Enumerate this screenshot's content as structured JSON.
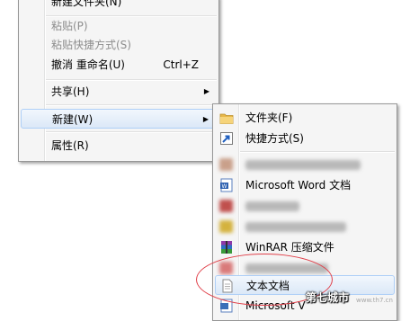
{
  "main_menu": {
    "top_partial": "新建文件夹(N)",
    "paste": "粘贴(P)",
    "paste_shortcut": "粘贴快捷方式(S)",
    "undo_rename": "撤消 重命名(U)",
    "undo_shortcut": "Ctrl+Z",
    "share": "共享(H)",
    "new": "新建(W)",
    "properties": "属性(R)"
  },
  "sub_menu": {
    "folder": "文件夹(F)",
    "shortcut": "快捷方式(S)",
    "word": "Microsoft Word 文档",
    "winrar": "WinRAR 压缩文件",
    "text_doc": "文本文档",
    "partial_bottom": "Microsoft V"
  },
  "watermark": {
    "site": "第七城市",
    "url": "www.th7.cn"
  }
}
